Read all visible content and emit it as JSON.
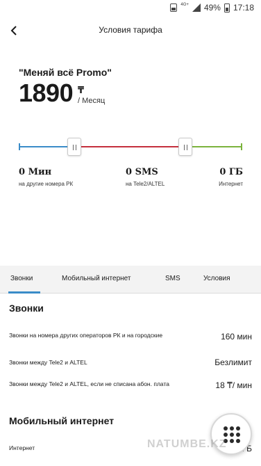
{
  "status_bar": {
    "network": "4G+",
    "battery": "49%",
    "time": "17:18",
    "icons": [
      "sim-icon",
      "signal-icon",
      "battery-icon"
    ]
  },
  "header": {
    "title": "Условия тарифа",
    "back_icon": "arrow-left-icon"
  },
  "tariff": {
    "name": "\"Меняй всё Promo\"",
    "price": "1890",
    "currency": "₸",
    "period": "/ Месяц"
  },
  "slider": {
    "colors": {
      "calls": "#3a8cc8",
      "sms": "#c42f3c",
      "internet": "#7bb33c"
    }
  },
  "allocation": [
    {
      "value": "0 Мин",
      "label": "на другие номера РК"
    },
    {
      "value": "0 SMS",
      "label": "на Tele2/ALTEL"
    },
    {
      "value": "0 ГБ",
      "label": "Интернет"
    }
  ],
  "tabs": [
    {
      "label": "Звонки",
      "active": true
    },
    {
      "label": "Мобильный интернет",
      "active": false
    },
    {
      "label": "SMS",
      "active": false
    },
    {
      "label": "Условия",
      "active": false
    }
  ],
  "accent_color": "#3a8cc8",
  "sections": {
    "calls": {
      "title": "Звонки",
      "rows": [
        {
          "label": "Звонки на номера других операторов РК и на городские",
          "value": "160 мин"
        },
        {
          "label": "Звонки между Tele2 и ALTEL",
          "value": "Безлимит"
        },
        {
          "label": "Звонки между Tele2 и ALTEL, если не списана абон. плата",
          "value": "18 ₸/ мин"
        }
      ]
    },
    "internet": {
      "title": "Мобильный интернет",
      "rows": [
        {
          "label": "Интернет",
          "value": "ГБ"
        }
      ]
    }
  },
  "fab": {
    "icon": "grid-menu-icon"
  },
  "watermark": "NATUMBE.KZ"
}
